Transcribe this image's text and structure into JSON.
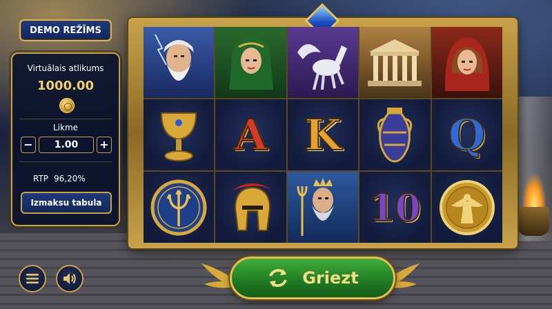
{
  "demo_badge": {
    "label": "DEMO REŽĪMS"
  },
  "info_panel": {
    "balance_label": "Virtuālais atlikums",
    "balance_value": "1000.00",
    "coin_icon": "coin-icon",
    "bet_label": "Likme",
    "bet_value": "1.00",
    "minus_label": "−",
    "plus_label": "+",
    "rtp_label": "RTP",
    "rtp_value": "96,20%",
    "paytable_label": "Izmaksu tabula"
  },
  "controls": {
    "menu_icon": "hamburger-menu-icon",
    "sound_icon": "speaker-icon",
    "spin_label": "Griezt",
    "spin_icon": "refresh-arrows-icon"
  },
  "reels": {
    "rows": [
      [
        "zeus",
        "green-haired-goddess",
        "pegasus",
        "greek-temple",
        "red-hooded-goddess"
      ],
      [
        "golden-chalice",
        "A",
        "K",
        "greek-amphora",
        "Q"
      ],
      [
        "trident-shield",
        "spartan-helmet",
        "poseidon",
        "10",
        "winged-goddess-coin"
      ]
    ]
  },
  "colors": {
    "gold": "#c9a24a",
    "panel_bg": "#0c142c",
    "spin_green": "#1f7a22",
    "accent_blue": "#1d3a82"
  }
}
